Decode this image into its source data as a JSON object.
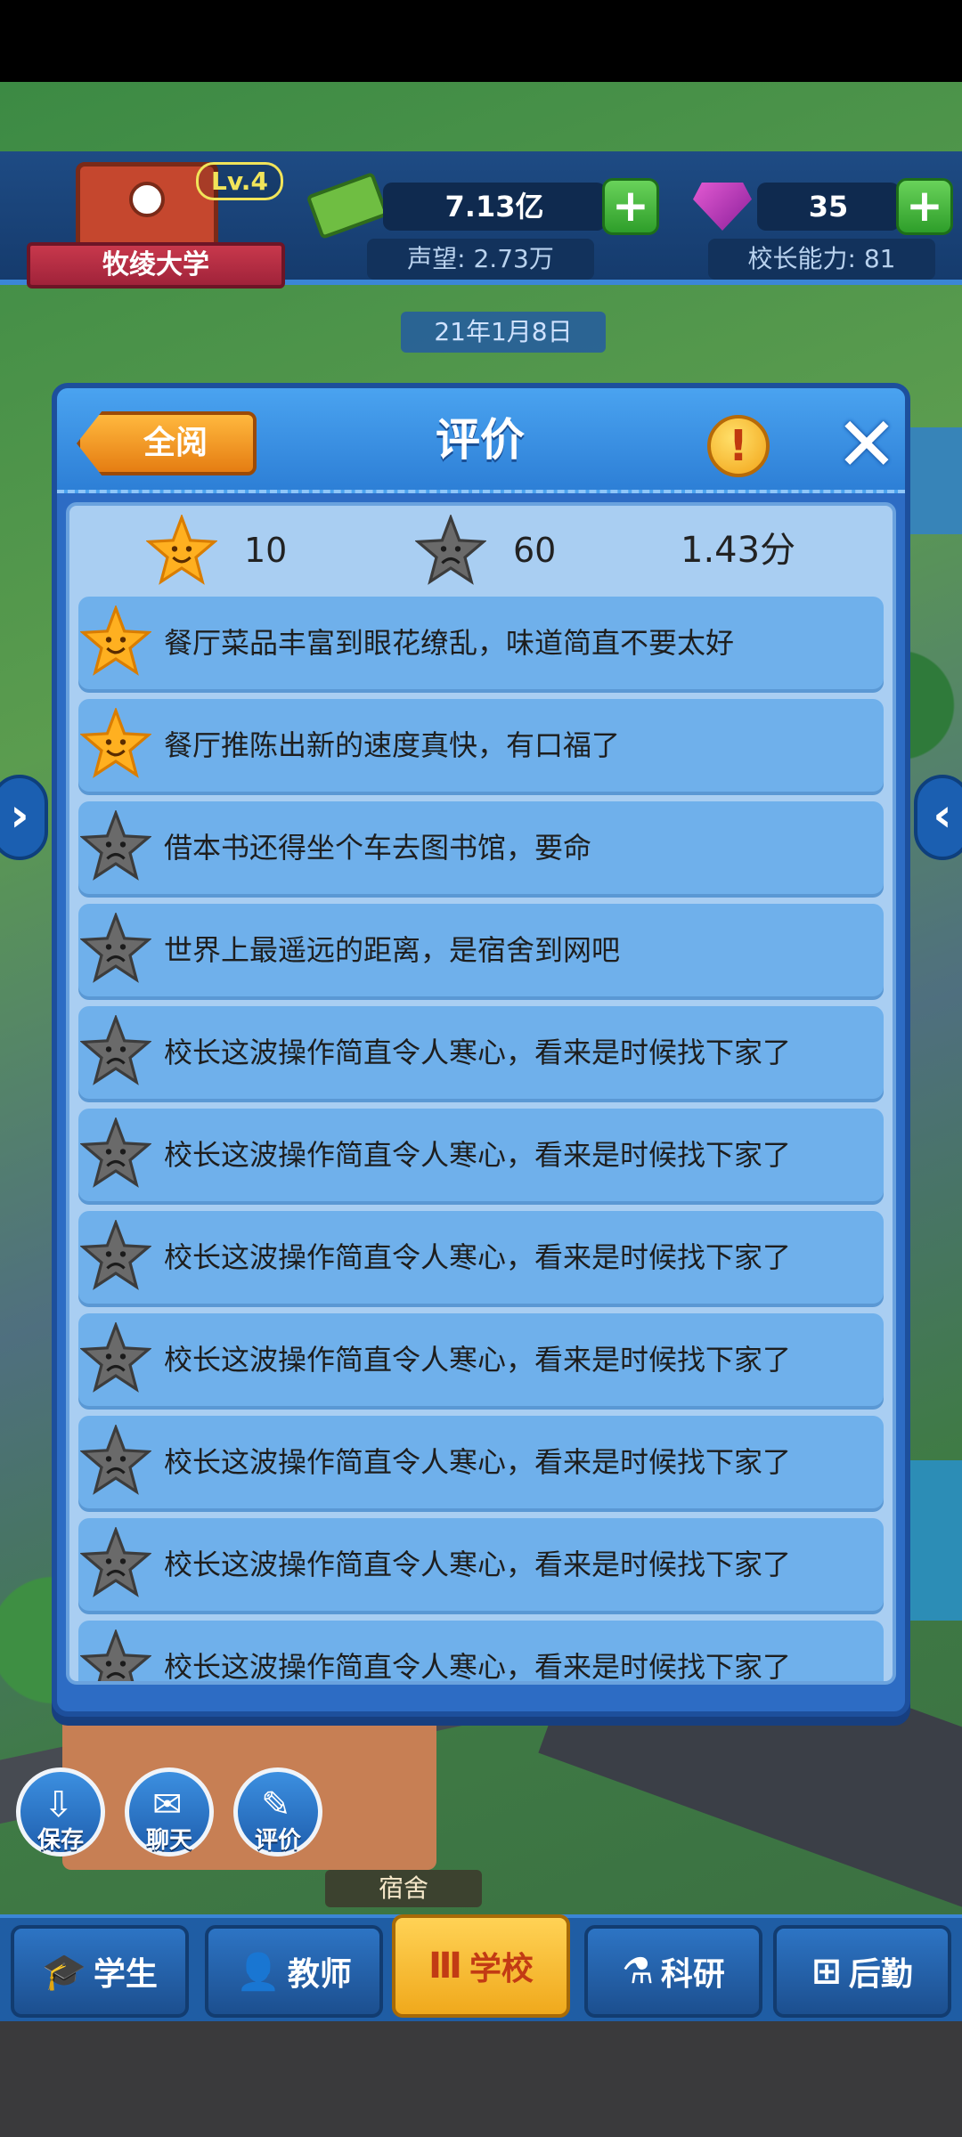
{
  "hud": {
    "school_name": "牧绫大学",
    "level": "Lv.4",
    "money": "7.13亿",
    "gems": "35",
    "reputation": "声望: 2.73万",
    "principal_ability": "校长能力: 81",
    "date": "21年1月8日",
    "plus_symbol": "+"
  },
  "dialog": {
    "title": "评价",
    "read_all_label": "全阅",
    "info_symbol": "!",
    "close_symbol": "✕",
    "summary": {
      "good_count": "10",
      "bad_count": "60",
      "score": "1.43分"
    },
    "reviews": [
      {
        "type": "good",
        "text": "餐厅菜品丰富到眼花缭乱，味道简直不要太好"
      },
      {
        "type": "good",
        "text": "餐厅推陈出新的速度真快，有口福了"
      },
      {
        "type": "bad",
        "text": "借本书还得坐个车去图书馆，要命"
      },
      {
        "type": "bad",
        "text": "世界上最遥远的距离，是宿舍到网吧"
      },
      {
        "type": "bad",
        "text": "校长这波操作简直令人寒心，看来是时候找下家了"
      },
      {
        "type": "bad",
        "text": "校长这波操作简直令人寒心，看来是时候找下家了"
      },
      {
        "type": "bad",
        "text": "校长这波操作简直令人寒心，看来是时候找下家了"
      },
      {
        "type": "bad",
        "text": "校长这波操作简直令人寒心，看来是时候找下家了"
      },
      {
        "type": "bad",
        "text": "校长这波操作简直令人寒心，看来是时候找下家了"
      },
      {
        "type": "bad",
        "text": "校长这波操作简直令人寒心，看来是时候找下家了"
      },
      {
        "type": "bad",
        "text": "校长这波操作简直令人寒心，看来是时候找下家了"
      }
    ]
  },
  "actions": {
    "save": "保存",
    "chat": "聊天",
    "review": "评价"
  },
  "building_label": "宿舍",
  "tabs": [
    {
      "label": "学生",
      "icon": "graduation-cap-icon"
    },
    {
      "label": "教师",
      "icon": "person-icon"
    },
    {
      "label": "学校",
      "icon": "school-pillars-icon"
    },
    {
      "label": "科研",
      "icon": "microscope-icon"
    },
    {
      "label": "后勤",
      "icon": "logistics-icon"
    }
  ],
  "colors": {
    "good_star": "#ffb020",
    "bad_star": "#6a6a6a",
    "active_tab": "#f0a91c",
    "dialog_blue": "#2d6cc4"
  }
}
